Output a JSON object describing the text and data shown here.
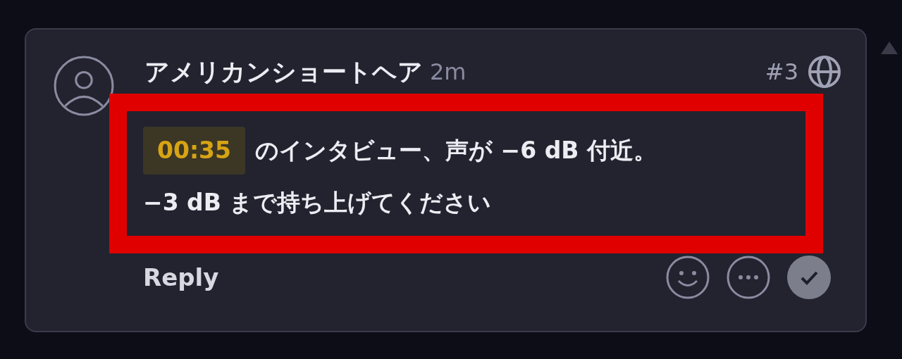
{
  "comment": {
    "author": "アメリカンショートヘア",
    "time": "2m",
    "number": "#3",
    "timestamp": "00:35",
    "lines": [
      "のインタビュー、声が −6 dB 付近。",
      "−3 dB まで持ち上げてください"
    ],
    "highlighted": true,
    "reply": "Reply"
  }
}
